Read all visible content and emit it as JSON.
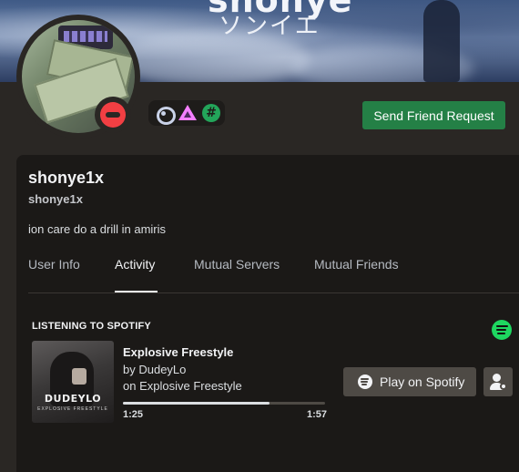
{
  "banner": {
    "title": "shonye",
    "subtitle": "ソンイエ"
  },
  "profile": {
    "display_name": "shonye1x",
    "username": "shonye1x",
    "bio": "ion care do a drill in amiris",
    "status": "do-not-disturb",
    "badges": [
      "nitro-icon",
      "hypesquad-icon",
      "hashtag-icon"
    ],
    "hash_glyph": "#"
  },
  "actions": {
    "friend_request_label": "Send Friend Request"
  },
  "tabs": [
    {
      "label": "User Info",
      "active": false
    },
    {
      "label": "Activity",
      "active": true
    },
    {
      "label": "Mutual Servers",
      "active": false
    },
    {
      "label": "Mutual Friends",
      "active": false
    }
  ],
  "activity": {
    "header": "LISTENING TO SPOTIFY",
    "track_title": "Explosive Freestyle",
    "artist": "by DudeyLo",
    "album": "on Explosive Freestyle",
    "album_art_text": "DUDEYLO",
    "album_art_subtext": "EXPLOSIVE FREESTYLE",
    "elapsed": "1:25",
    "total": "1:57",
    "progress_fraction": 0.726,
    "play_label": "Play on Spotify"
  },
  "colors": {
    "accent_green": "#248046",
    "spotify_green": "#1ed760",
    "dnd_red": "#f23f43",
    "background": "#2a2724",
    "card": "#1b1917"
  }
}
